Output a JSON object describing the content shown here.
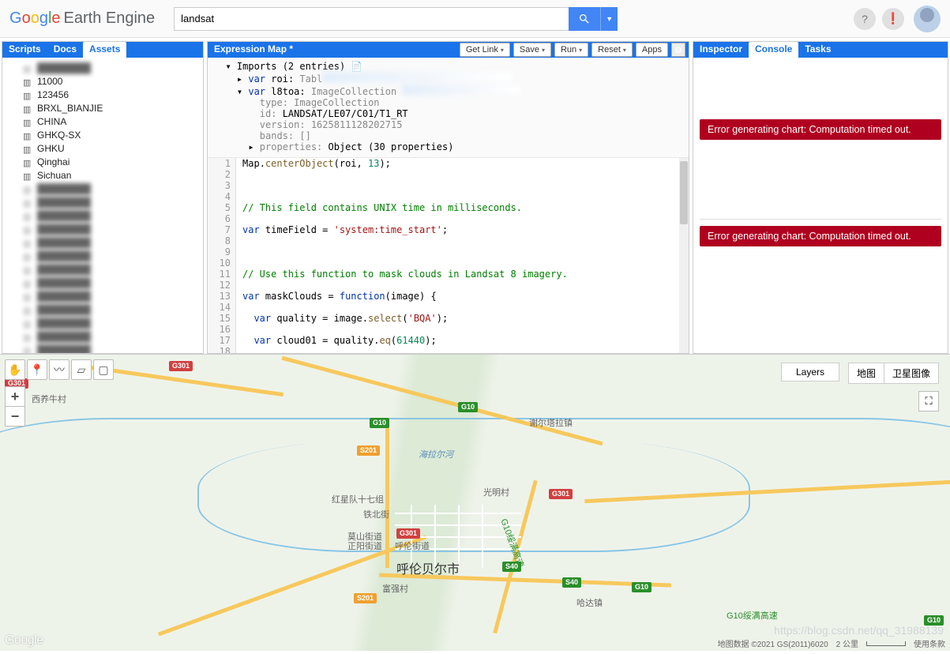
{
  "header": {
    "logo_google": "Google",
    "logo_rest": "Earth Engine",
    "search_value": "landsat"
  },
  "left_tabs": {
    "scripts": "Scripts",
    "docs": "Docs",
    "assets": "Assets"
  },
  "assets": [
    {
      "name": "",
      "blur": true
    },
    {
      "name": "11000",
      "blur": false
    },
    {
      "name": "123456",
      "blur": false
    },
    {
      "name": "BRXL_BIANJIE",
      "blur": false
    },
    {
      "name": "CHINA",
      "blur": false
    },
    {
      "name": "GHKQ-SX",
      "blur": false
    },
    {
      "name": "GHKU",
      "blur": false
    },
    {
      "name": "Qinghai",
      "blur": false
    },
    {
      "name": "Sichuan",
      "blur": false
    },
    {
      "name": "",
      "blur": true
    },
    {
      "name": "",
      "blur": true
    },
    {
      "name": "",
      "blur": true
    },
    {
      "name": "",
      "blur": true
    },
    {
      "name": "",
      "blur": true
    },
    {
      "name": "",
      "blur": true
    },
    {
      "name": "",
      "blur": true
    },
    {
      "name": "",
      "blur": true
    },
    {
      "name": "",
      "blur": true
    },
    {
      "name": "",
      "blur": true
    },
    {
      "name": "",
      "blur": true
    },
    {
      "name": "",
      "blur": true
    },
    {
      "name": "",
      "blur": true
    }
  ],
  "editor": {
    "title": "Expression Map *",
    "buttons": {
      "getlink": "Get Link",
      "save": "Save",
      "run": "Run",
      "reset": "Reset",
      "apps": "Apps"
    },
    "imports": {
      "header": "Imports (2 entries)",
      "roi_decl": "var roi: Tabl",
      "l8_decl": "var l8toa: ImageCollection",
      "type": "type: ImageCollection",
      "id": "id: LANDSAT/LE07/C01/T1_RT",
      "version": "version: 1625811128202715",
      "bands": "bands: []",
      "props": "properties: Object (30 properties)"
    },
    "line_start": 1,
    "lines": [
      {
        "n": 1,
        "raw": "Map.centerObject(roi, 13);"
      },
      {
        "n": 2,
        "raw": ""
      },
      {
        "n": 3,
        "raw": ""
      },
      {
        "n": 4,
        "raw": ""
      },
      {
        "n": 5,
        "raw": "// This field contains UNIX time in milliseconds."
      },
      {
        "n": 6,
        "raw": ""
      },
      {
        "n": 7,
        "raw": "var timeField = 'system:time_start';"
      },
      {
        "n": 8,
        "raw": ""
      },
      {
        "n": 9,
        "raw": ""
      },
      {
        "n": 10,
        "raw": ""
      },
      {
        "n": 11,
        "raw": "// Use this function to mask clouds in Landsat 8 imagery."
      },
      {
        "n": 12,
        "raw": ""
      },
      {
        "n": 13,
        "raw": "var maskClouds = function(image) {"
      },
      {
        "n": 14,
        "raw": ""
      },
      {
        "n": 15,
        "raw": "  var quality = image.select('BQA');"
      },
      {
        "n": 16,
        "raw": ""
      },
      {
        "n": 17,
        "raw": "  var cloud01 = quality.eq(61440);"
      },
      {
        "n": 18,
        "raw": ""
      }
    ]
  },
  "right_tabs": {
    "inspector": "Inspector",
    "console": "Console",
    "tasks": "Tasks"
  },
  "console_errors": [
    "Error generating chart: Computation timed out.",
    "Error generating chart: Computation timed out."
  ],
  "map": {
    "layers_label": "Layers",
    "type_map": "地图",
    "type_sat": "卫星图像",
    "city": "呼伦贝尔市",
    "places": {
      "xiyang": "西养牛村",
      "xierta": "谢尔塔拉镇",
      "guangming": "光明村",
      "hongxing": "红星队十七组",
      "tiebei": "铁北街",
      "moshan": "莫山街道",
      "zhengyang": "正阳街道",
      "huluun": "呼伦街道",
      "fuqiang": "富强村",
      "haila": "海拉尔河",
      "hada": "哈达镇"
    },
    "shields": {
      "g301": "G301",
      "g10": "G10",
      "s201": "S201",
      "s40": "S40",
      "g10ring": "G10绥满高速"
    },
    "attr": {
      "data": "地图数据 ©2021 GS(2011)6020",
      "scale": "2 公里",
      "terms": "使用条款"
    },
    "watermark": "https://blog.csdn.net/qq_31988139",
    "googlelogo": "Google"
  }
}
